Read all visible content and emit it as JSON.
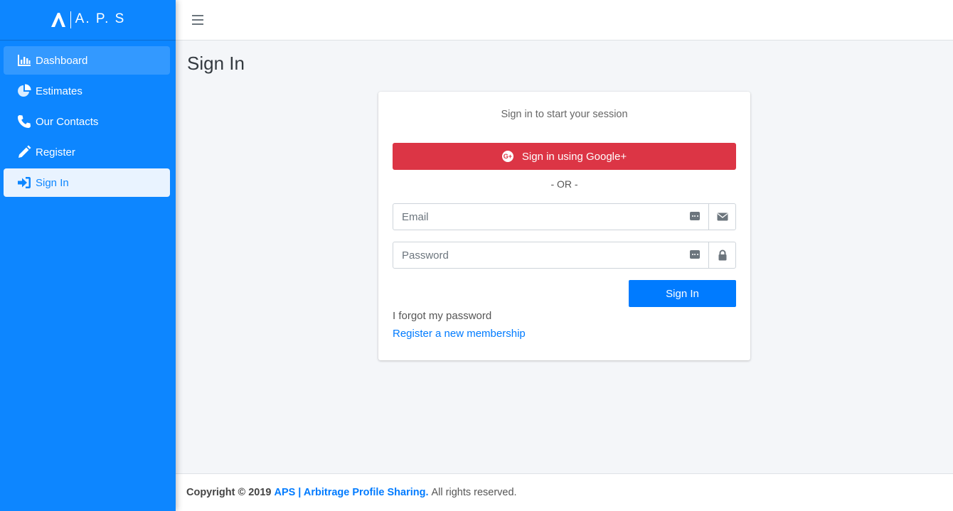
{
  "brand": {
    "text": "A. P. S"
  },
  "sidebar": {
    "items": [
      {
        "label": "Dashboard",
        "icon": "chart-bar-icon"
      },
      {
        "label": "Estimates",
        "icon": "chart-pie-icon"
      },
      {
        "label": "Our Contacts",
        "icon": "phone-icon"
      },
      {
        "label": "Register",
        "icon": "pen-icon"
      },
      {
        "label": "Sign In",
        "icon": "sign-in-icon"
      }
    ]
  },
  "page": {
    "title": "Sign In"
  },
  "login": {
    "message": "Sign in to start your session",
    "google_button": "Sign in using Google+",
    "google_glyph": "G+",
    "or_text": "- OR -",
    "email_placeholder": "Email",
    "password_placeholder": "Password",
    "submit_button": "Sign In",
    "forgot_link": "I forgot my password",
    "register_link": "Register a new membership"
  },
  "footer": {
    "copyright": "Copyright © 2019",
    "brand": "APS | Arbitrage Profile Sharing.",
    "rights": "All rights reserved."
  },
  "colors": {
    "sidebar": "#0d86ff",
    "primary": "#007bff",
    "danger": "#dc3545",
    "background": "#f4f6f9"
  }
}
